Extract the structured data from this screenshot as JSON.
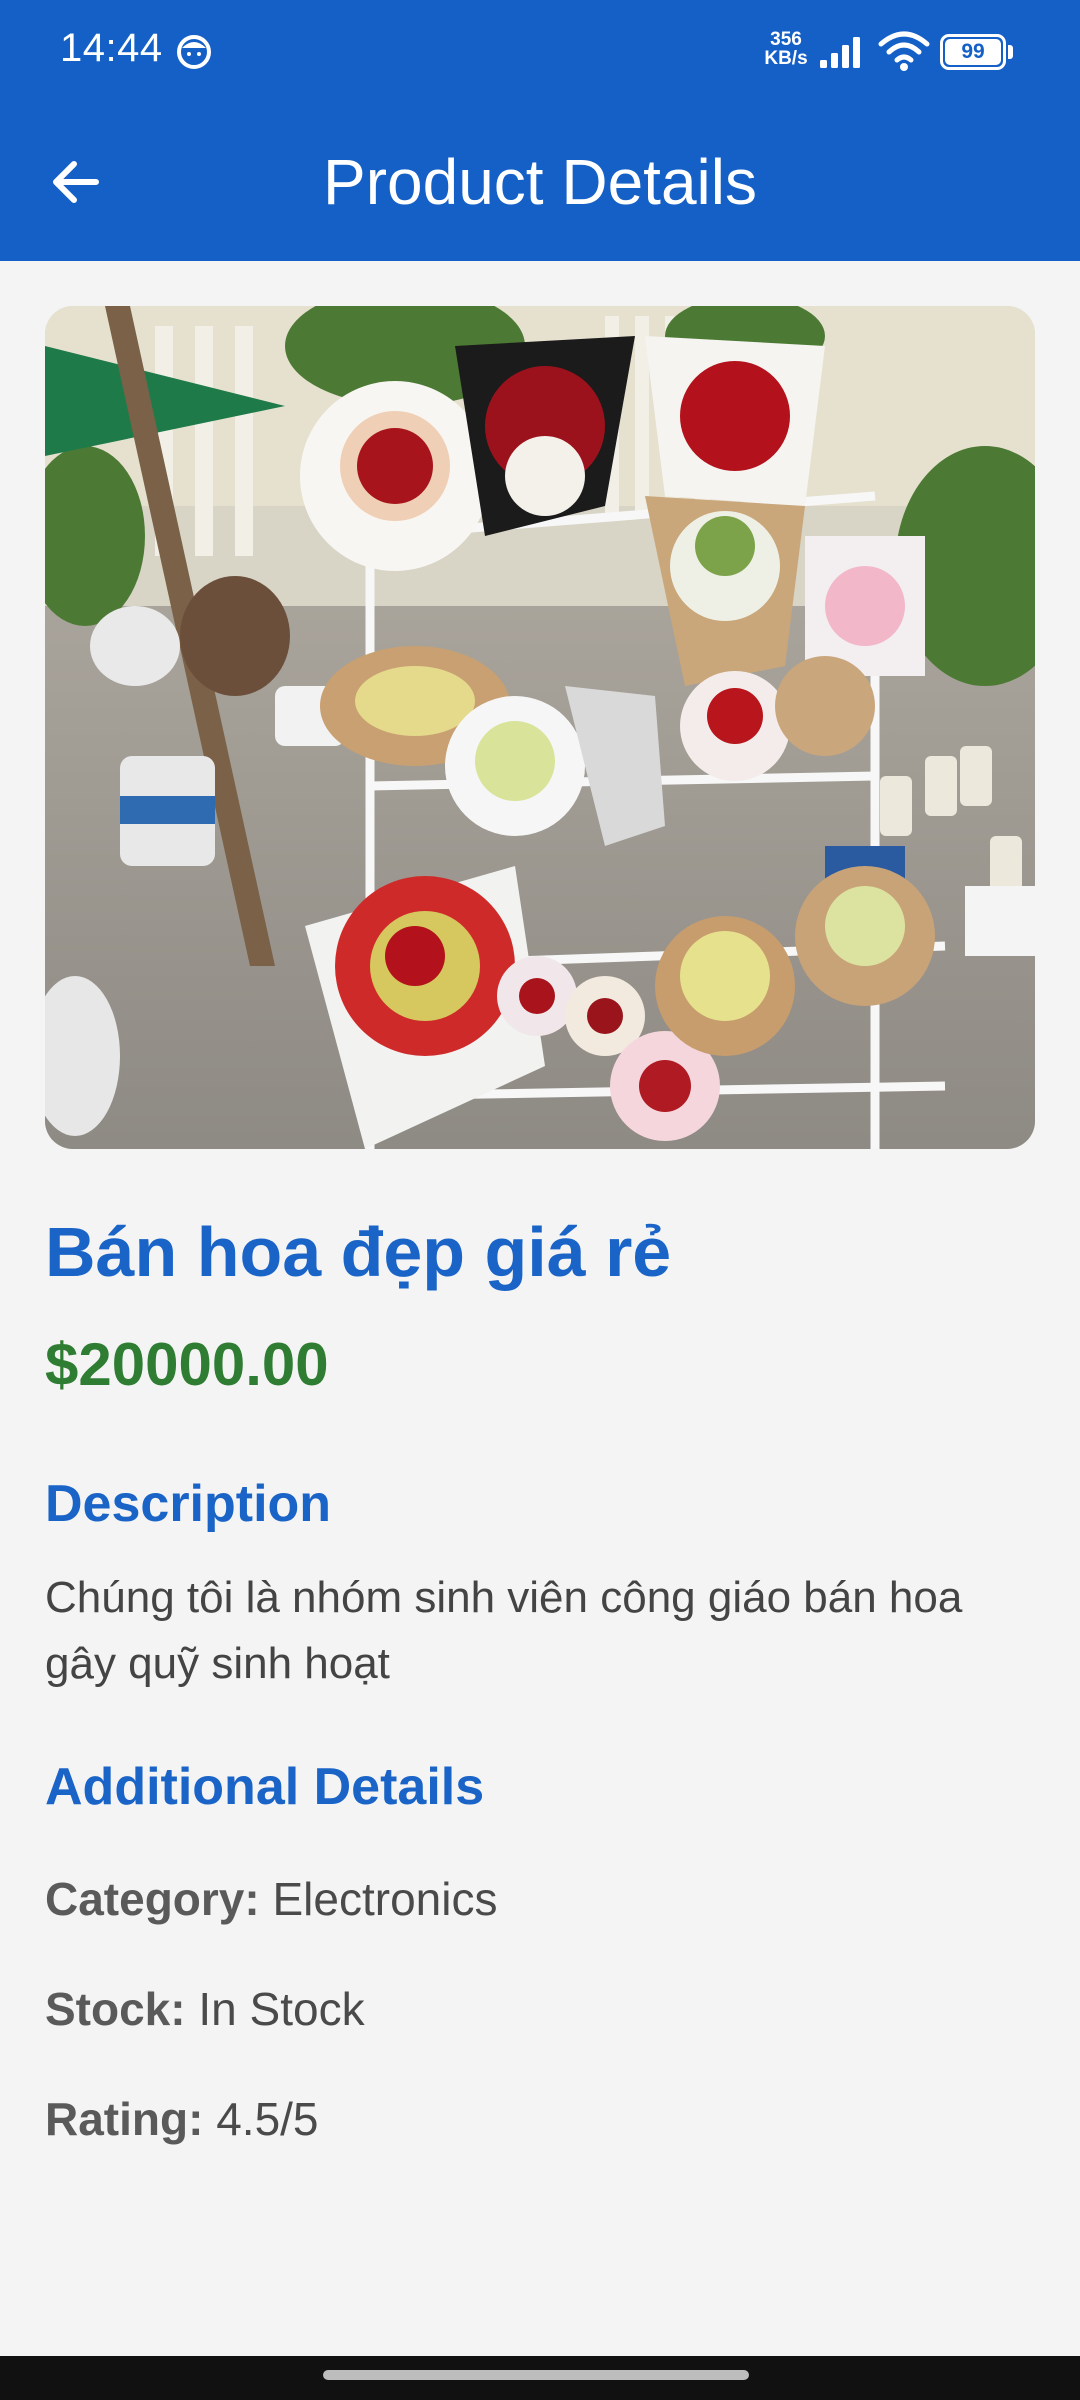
{
  "status_bar": {
    "time": "14:44",
    "net_speed_value": "356",
    "net_speed_unit": "KB/s",
    "battery_level": "99"
  },
  "app_bar": {
    "title": "Product Details",
    "back_icon": "arrow-left-icon"
  },
  "product": {
    "name": "Bán hoa đẹp giá rẻ",
    "price": "$20000.00",
    "image_icon": "flower-bouquets-photo"
  },
  "description": {
    "heading": "Description",
    "text": "Chúng tôi là nhóm sinh viên công giáo bán hoa gây quỹ sinh hoạt"
  },
  "additional_details": {
    "heading": "Additional Details",
    "category_label": "Category:",
    "category_value": "Electronics",
    "stock_label": "Stock:",
    "stock_value": "In Stock",
    "rating_label": "Rating:",
    "rating_value": "4.5/5"
  },
  "colors": {
    "primary": "#1560c7",
    "heading_blue": "#1a64c8",
    "price_green": "#2e7d32",
    "background": "#f4f4f4"
  }
}
